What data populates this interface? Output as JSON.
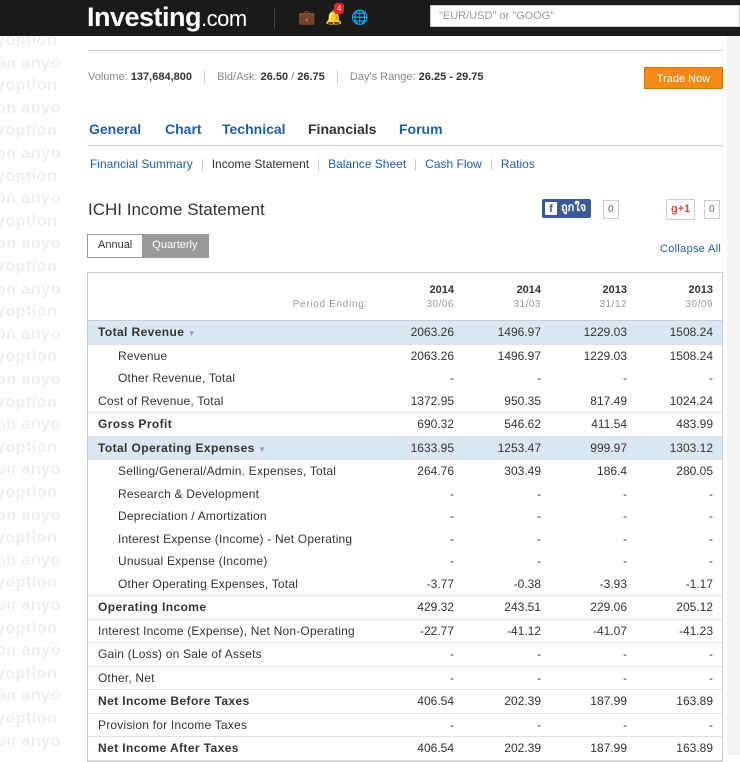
{
  "header": {
    "logo_main": "Investing",
    "logo_suffix": ".com",
    "notifications_count": "4",
    "search_placeholder": "\"EUR/USD\" or \"GOOG\""
  },
  "watermark": [
    "yoption",
    "on anyo"
  ],
  "quote_bar": {
    "volume_label": "Volume:",
    "volume_value": "137,684,800",
    "bidask_label": "Bid/Ask:",
    "bid": "26.50",
    "ask_sep": "/",
    "ask": "26.75",
    "range_label": "Day's Range:",
    "range_value": "26.25 - 29.75",
    "trade_button": "Trade Now"
  },
  "tabs": [
    {
      "label": "General",
      "active": false
    },
    {
      "label": "Chart",
      "active": false
    },
    {
      "label": "Technical",
      "active": false
    },
    {
      "label": "Financials",
      "active": true
    },
    {
      "label": "Forum",
      "active": false
    }
  ],
  "subtabs": [
    {
      "label": "Financial Summary",
      "active": false
    },
    {
      "label": "Income Statement",
      "active": true
    },
    {
      "label": "Balance Sheet",
      "active": false
    },
    {
      "label": "Cash Flow",
      "active": false
    },
    {
      "label": "Ratios",
      "active": false
    }
  ],
  "page_title": "ICHI Income Statement",
  "social": {
    "facebook_label": "ถูกใจ",
    "facebook_count": "0",
    "gplus_label": "+1",
    "gplus_count": "0"
  },
  "period_toggle": {
    "annual": "Annual",
    "quarterly": "Quarterly",
    "selected": "Annual"
  },
  "collapse_label": "Collapse All",
  "table": {
    "period_label": "Period Ending:",
    "columns": [
      {
        "year": "2014",
        "date": "30/06"
      },
      {
        "year": "2014",
        "date": "31/03"
      },
      {
        "year": "2013",
        "date": "31/12"
      },
      {
        "year": "2013",
        "date": "30/09"
      }
    ],
    "rows": [
      {
        "label": "Total Revenue",
        "values": [
          "2063.26",
          "1496.97",
          "1229.03",
          "1508.24"
        ],
        "style": "bold-hl",
        "expandable": true
      },
      {
        "label": "Revenue",
        "values": [
          "2063.26",
          "1496.97",
          "1229.03",
          "1508.24"
        ],
        "style": "child"
      },
      {
        "label": "Other Revenue, Total",
        "values": [
          "-",
          "-",
          "-",
          "-"
        ],
        "style": "child"
      },
      {
        "label": "Cost of Revenue, Total",
        "values": [
          "1372.95",
          "950.35",
          "817.49",
          "1024.24"
        ],
        "style": "normal"
      },
      {
        "label": "Gross Profit",
        "values": [
          "690.32",
          "546.62",
          "411.54",
          "483.99"
        ],
        "style": "bold"
      },
      {
        "label": "Total Operating Expenses",
        "values": [
          "1633.95",
          "1253.47",
          "999.97",
          "1303.12"
        ],
        "style": "bold-hl",
        "expandable": true
      },
      {
        "label": "Selling/General/Admin. Expenses, Total",
        "values": [
          "264.76",
          "303.49",
          "186.4",
          "280.05"
        ],
        "style": "child"
      },
      {
        "label": "Research & Development",
        "values": [
          "-",
          "-",
          "-",
          "-"
        ],
        "style": "child"
      },
      {
        "label": "Depreciation / Amortization",
        "values": [
          "-",
          "-",
          "-",
          "-"
        ],
        "style": "child"
      },
      {
        "label": "Interest Expense (Income) - Net Operating",
        "values": [
          "-",
          "-",
          "-",
          "-"
        ],
        "style": "child"
      },
      {
        "label": "Unusual Expense (Income)",
        "values": [
          "-",
          "-",
          "-",
          "-"
        ],
        "style": "child"
      },
      {
        "label": "Other Operating Expenses, Total",
        "values": [
          "-3.77",
          "-0.38",
          "-3.93",
          "-1.17"
        ],
        "style": "child-last"
      },
      {
        "label": "Operating Income",
        "values": [
          "429.32",
          "243.51",
          "229.06",
          "205.12"
        ],
        "style": "bold"
      },
      {
        "label": "Interest Income (Expense), Net Non-Operating",
        "values": [
          "-22.77",
          "-41.12",
          "-41.07",
          "-41.23"
        ],
        "style": "normal"
      },
      {
        "label": "Gain (Loss) on Sale of Assets",
        "values": [
          "-",
          "-",
          "-",
          "-"
        ],
        "style": "normal"
      },
      {
        "label": "Other, Net",
        "values": [
          "-",
          "-",
          "-",
          "-"
        ],
        "style": "normal"
      },
      {
        "label": "Net Income Before Taxes",
        "values": [
          "406.54",
          "202.39",
          "187.99",
          "163.89"
        ],
        "style": "bold"
      },
      {
        "label": "Provision for Income Taxes",
        "values": [
          "-",
          "-",
          "-",
          "-"
        ],
        "style": "normal"
      },
      {
        "label": "Net Income After Taxes",
        "values": [
          "406.54",
          "202.39",
          "187.99",
          "163.89"
        ],
        "style": "bold"
      }
    ]
  }
}
